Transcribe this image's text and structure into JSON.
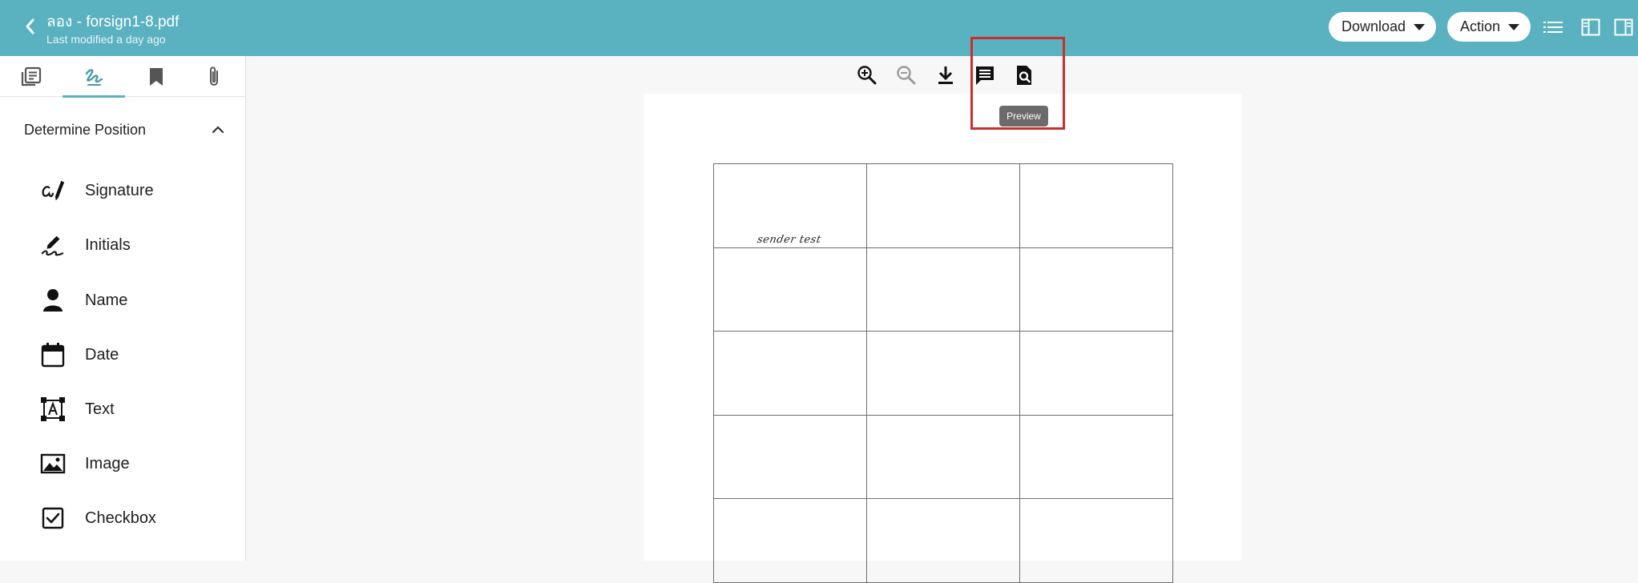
{
  "header": {
    "title": "ลอง - forsign1-8.pdf",
    "subtitle": "Last modified a day ago",
    "download_label": "Download",
    "action_label": "Action",
    "icons": [
      "back-icon",
      "list-icon",
      "layout-left-icon",
      "layout-right-icon"
    ]
  },
  "sidebar": {
    "tabs": [
      {
        "name": "documents-tab",
        "icon": "library-books-icon",
        "active": false
      },
      {
        "name": "sign-tab",
        "icon": "signature-icon",
        "active": true
      },
      {
        "name": "bookmark-tab",
        "icon": "bookmark-icon",
        "active": false
      },
      {
        "name": "attachment-tab",
        "icon": "paperclip-icon",
        "active": false
      }
    ],
    "section_title": "Determine Position",
    "fields": [
      {
        "label": "Signature",
        "icon": "signature-pen-icon"
      },
      {
        "label": "Initials",
        "icon": "initials-pen-icon"
      },
      {
        "label": "Name",
        "icon": "person-icon"
      },
      {
        "label": "Date",
        "icon": "calendar-icon"
      },
      {
        "label": "Text",
        "icon": "text-box-icon"
      },
      {
        "label": "Image",
        "icon": "image-icon"
      },
      {
        "label": "Checkbox",
        "icon": "checkbox-icon"
      }
    ]
  },
  "viewer": {
    "toolbar_icons": [
      "zoom-in-icon",
      "zoom-out-icon",
      "download-icon",
      "comment-icon",
      "preview-icon"
    ],
    "tooltip": "Preview",
    "signature_text": "sender test",
    "accent_color": "#5ab1bf",
    "highlight_color": "#c9302c"
  }
}
